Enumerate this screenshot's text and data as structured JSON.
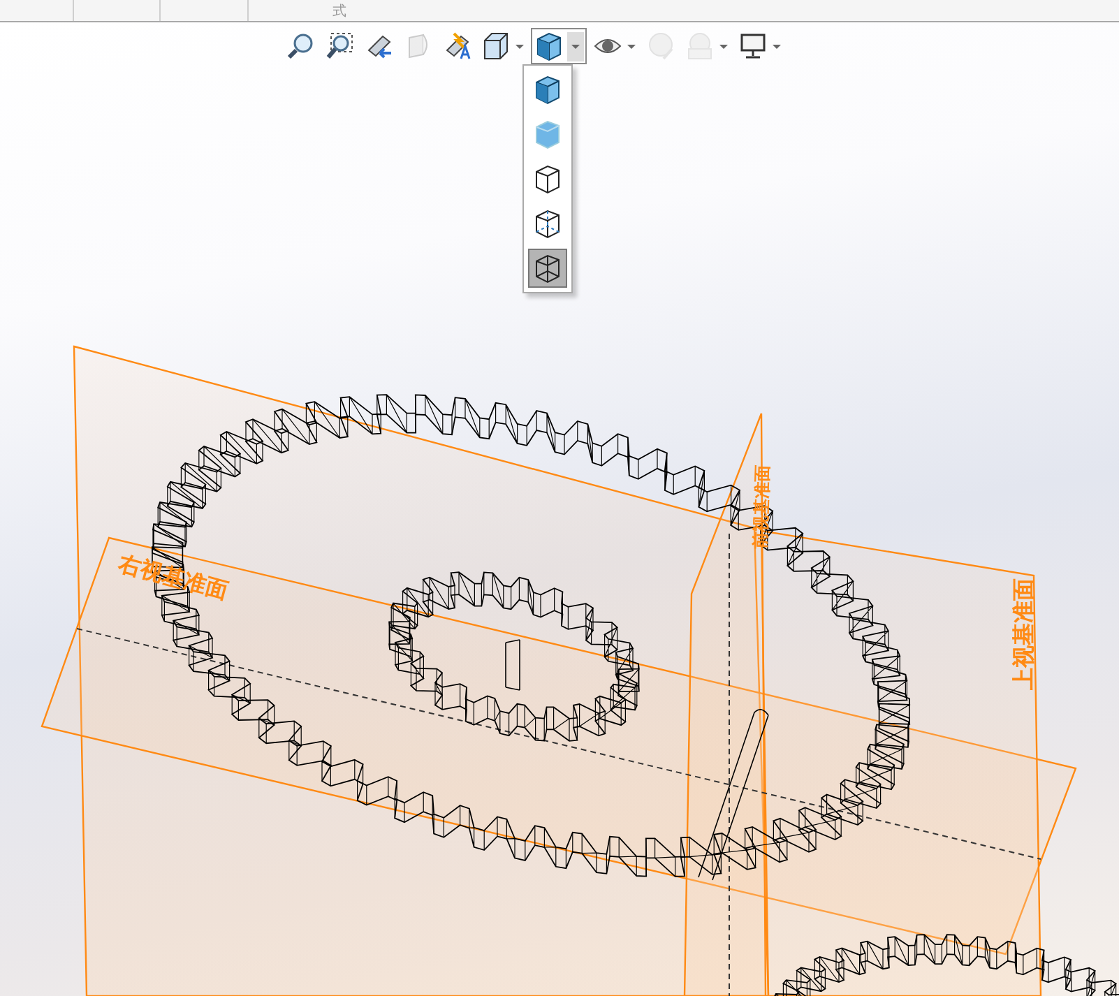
{
  "top_strip": {
    "text": "式"
  },
  "toolbar": {
    "items": [
      {
        "has_menu": false,
        "disabled": false,
        "open": false
      },
      {
        "has_menu": false,
        "disabled": false,
        "open": false
      },
      {
        "has_menu": false,
        "disabled": false,
        "open": false
      },
      {
        "has_menu": false,
        "disabled": true,
        "open": false
      },
      {
        "has_menu": false,
        "disabled": false,
        "open": false
      },
      {
        "has_menu": true,
        "disabled": false,
        "open": false
      },
      {
        "has_menu": true,
        "disabled": false,
        "open": true
      },
      {
        "has_menu": true,
        "disabled": false,
        "open": false
      },
      {
        "has_menu": false,
        "disabled": true,
        "open": false
      },
      {
        "has_menu": true,
        "disabled": true,
        "open": false
      },
      {
        "has_menu": true,
        "disabled": false,
        "open": false
      }
    ]
  },
  "display_style_menu": {
    "items": [
      {
        "selected": false
      },
      {
        "selected": false
      },
      {
        "selected": false
      },
      {
        "selected": false
      },
      {
        "selected": true
      }
    ]
  },
  "viewport": {
    "planes": [
      {
        "label": "右视基准面"
      },
      {
        "label": "上视基准面"
      },
      {
        "label": "前视基准面"
      }
    ]
  }
}
